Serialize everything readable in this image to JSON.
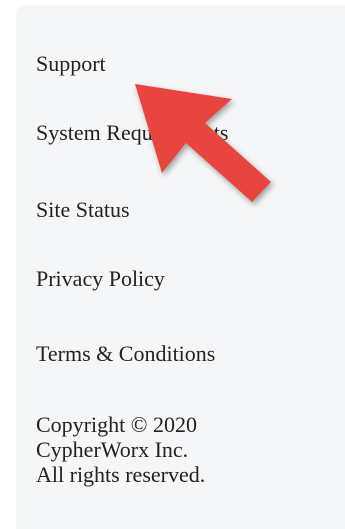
{
  "footer": {
    "links": [
      "Support",
      "System Requirements",
      "Site Status",
      "Privacy Policy",
      "Terms & Conditions"
    ],
    "copyright": {
      "line1": "Copyright © 2020",
      "line2": "CypherWorx Inc.",
      "line3": "All rights reserved."
    }
  },
  "annotation": {
    "arrow_color": "#e8453f",
    "arrow_icon": "arrow-pointer-icon"
  }
}
